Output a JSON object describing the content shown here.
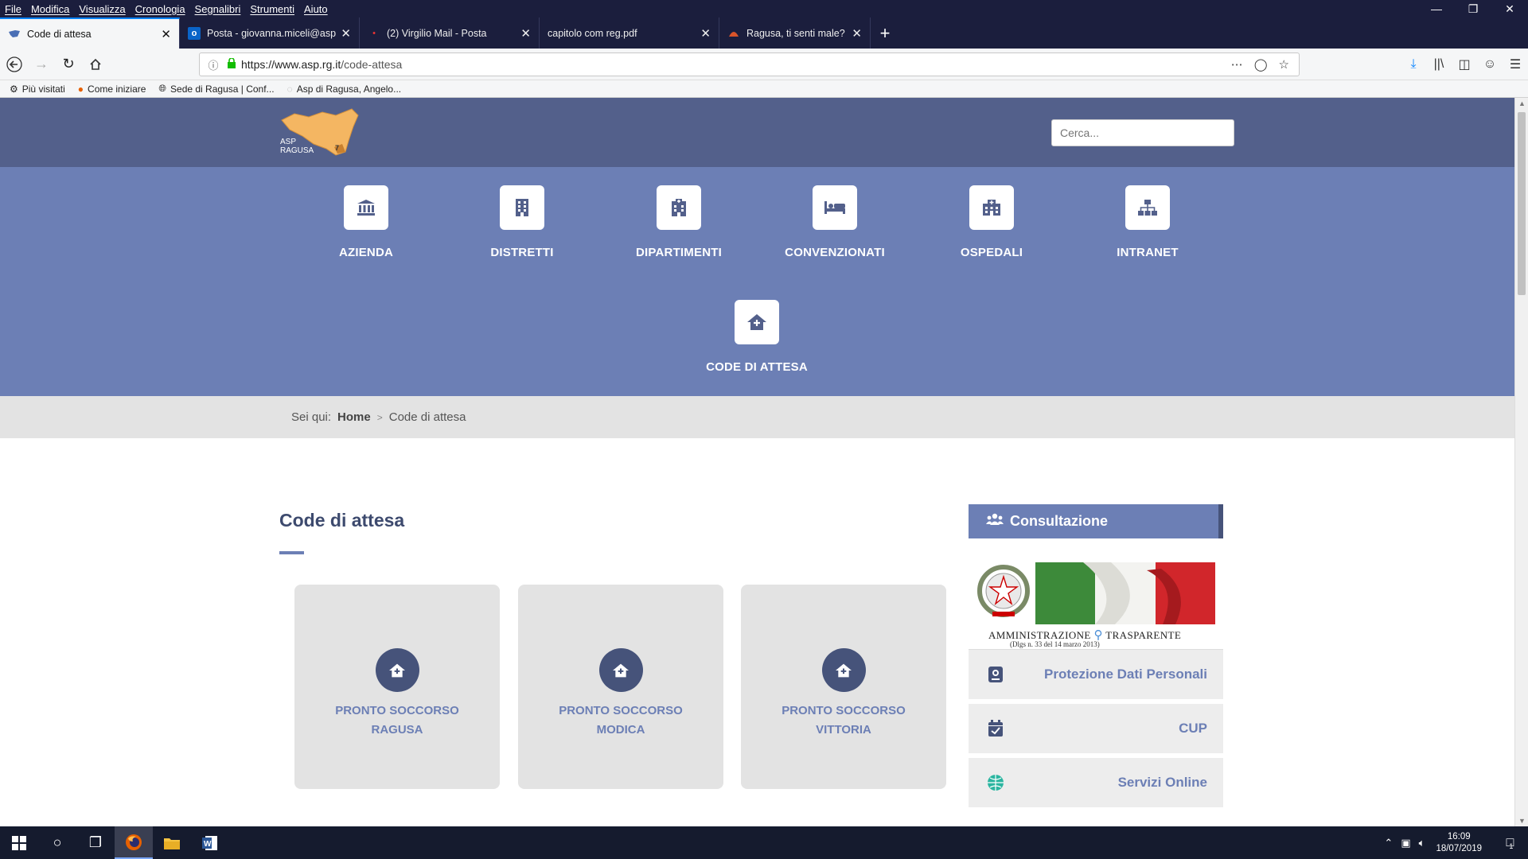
{
  "browser": {
    "menu": [
      "File",
      "Modifica",
      "Visualizza",
      "Cronologia",
      "Segnalibri",
      "Strumenti",
      "Aiuto"
    ],
    "tabs": [
      {
        "title": "Code di attesa",
        "active": true,
        "icon": "sicily-favicon"
      },
      {
        "title": "Posta - giovanna.miceli@asp.r",
        "active": false,
        "icon": "outlook-icon"
      },
      {
        "title": "(2) Virgilio Mail - Posta",
        "active": false,
        "icon": "virgilio-dot-icon"
      },
      {
        "title": "capitolo com reg.pdf",
        "active": false,
        "icon": "pdf-icon"
      },
      {
        "title": "Ragusa, ti senti male? Scegli il P",
        "active": false,
        "icon": "news-icon"
      }
    ],
    "url_host": "https://www.asp.rg.it",
    "url_path": "/code-attesa",
    "bookmarks": [
      {
        "label": "Più visitati",
        "icon": "gear-icon"
      },
      {
        "label": "Come iniziare",
        "icon": "firefox-icon"
      },
      {
        "label": "Sede di Ragusa | Conf...",
        "icon": "globe-icon"
      },
      {
        "label": "Asp di Ragusa, Angelo...",
        "icon": "bookmark-icon"
      }
    ]
  },
  "site": {
    "logo_line1": "ASP",
    "logo_line2": "RAGUSA",
    "logo_badge": "7",
    "search_placeholder": "Cerca...",
    "nav": [
      {
        "label": "AZIENDA",
        "icon": "bank-icon"
      },
      {
        "label": "DISTRETTI",
        "icon": "building-icon"
      },
      {
        "label": "DIPARTIMENTI",
        "icon": "hospital-building-icon"
      },
      {
        "label": "CONVENZIONATI",
        "icon": "bed-icon"
      },
      {
        "label": "OSPEDALI",
        "icon": "hospital-icon"
      },
      {
        "label": "INTRANET",
        "icon": "sitemap-icon"
      },
      {
        "label": "CODE DI ATTESA",
        "icon": "clinic-house-icon"
      }
    ],
    "breadcrumb": {
      "prefix": "Sei qui:",
      "home": "Home",
      "sep": ">",
      "current": "Code di attesa"
    },
    "page_title": "Code di attesa",
    "cards": [
      {
        "line1": "PRONTO SOCCORSO",
        "line2": "RAGUSA"
      },
      {
        "line1": "PRONTO SOCCORSO",
        "line2": "MODICA"
      },
      {
        "line1": "PRONTO SOCCORSO",
        "line2": "VITTORIA"
      }
    ],
    "sidebar": {
      "title": "Consultazione",
      "trasparente_title": "AMMINISTRAZIONE",
      "trasparente_title2": "TRASPARENTE",
      "trasparente_sub": "(Dlgs n. 33 del 14 marzo 2013)",
      "items": [
        {
          "label": "Protezione Dati Personali",
          "icon": "shield-user-icon"
        },
        {
          "label": "CUP",
          "icon": "calendar-check-icon"
        },
        {
          "label": "Servizi Online",
          "icon": "globe-icon"
        }
      ]
    }
  },
  "taskbar": {
    "time": "16:09",
    "date": "18/07/2019",
    "notif_count": "1"
  },
  "colors": {
    "header": "#53608b",
    "nav": "#6c7fb5",
    "accent_dark": "#46537a"
  }
}
